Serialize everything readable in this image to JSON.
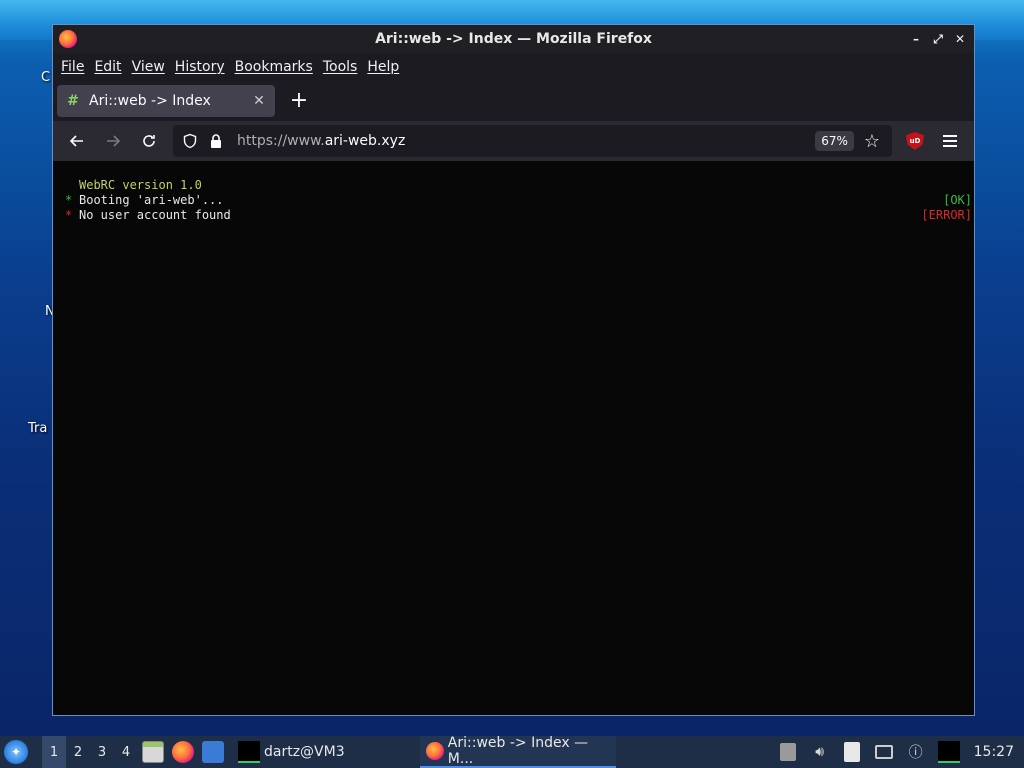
{
  "desktop": {
    "labels": [
      "C",
      "N",
      "Tra"
    ]
  },
  "window": {
    "title": "Ari::web -> Index — Mozilla Firefox",
    "controls": {
      "minimize": "–",
      "maximize": "⤢",
      "close": "✕"
    }
  },
  "menubar": {
    "items": [
      "File",
      "Edit",
      "View",
      "History",
      "Bookmarks",
      "Tools",
      "Help"
    ]
  },
  "tabs": [
    {
      "title": "Ari::web -> Index",
      "icon": "#"
    }
  ],
  "newtab_label": "+",
  "navbar": {
    "url_scheme": "https://www.",
    "url_host": "ari-web.xyz",
    "zoom": "67%",
    "ublock_label": "uD"
  },
  "terminal": {
    "header": "WebRC version 1.0",
    "lines": [
      {
        "bullet": "*",
        "text": "Booting 'ari-web'...",
        "status": "[OK]",
        "kind": "ok"
      },
      {
        "bullet": "*",
        "text": "No user account found",
        "status": "[ERROR]",
        "kind": "err"
      }
    ]
  },
  "taskbar": {
    "workspaces": [
      "1",
      "2",
      "3",
      "4"
    ],
    "active_workspace": "1",
    "terminal_task": "dartz@VM3",
    "firefox_task": "Ari::web -> Index — M...",
    "clock": "15:27"
  },
  "colors": {
    "ok": "#3fb93f",
    "error": "#d92a2a",
    "header": "#c2d06a",
    "window_border": "#6a8ec6"
  }
}
